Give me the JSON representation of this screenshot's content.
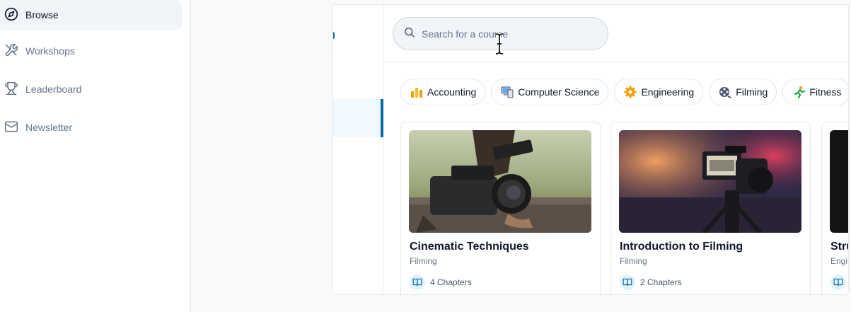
{
  "sidebar": {
    "items": [
      {
        "label": "Browse",
        "icon": "compass-icon",
        "active": true
      },
      {
        "label": "Workshops",
        "icon": "tools-icon",
        "active": false
      },
      {
        "label": "Leaderboard",
        "icon": "trophy-icon",
        "active": false
      },
      {
        "label": "Newsletter",
        "icon": "mail-icon",
        "active": false
      }
    ]
  },
  "search": {
    "placeholder": "Search for a course",
    "value": ""
  },
  "categories": [
    {
      "label": "Accounting",
      "icon": "bar-chart-emoji"
    },
    {
      "label": "Computer Science",
      "icon": "computer-emoji"
    },
    {
      "label": "Engineering",
      "icon": "gear-emoji"
    },
    {
      "label": "Filming",
      "icon": "film-reel-emoji"
    },
    {
      "label": "Fitness",
      "icon": "runner-emoji"
    }
  ],
  "courses": [
    {
      "title": "Cinematic Techniques",
      "category": "Filming",
      "chapters": "4 Chapters",
      "image": "cinema-camera-photo"
    },
    {
      "title": "Introduction to Filming",
      "category": "Filming",
      "chapters": "2 Chapters",
      "image": "camera-on-tripod-photo"
    },
    {
      "title": "Stru",
      "category": "Engi",
      "chapters": "",
      "image": "dark-photo"
    }
  ],
  "colors": {
    "accent": "#0369a1",
    "chip_border": "#e5e7eb",
    "muted_text": "#64748b"
  }
}
